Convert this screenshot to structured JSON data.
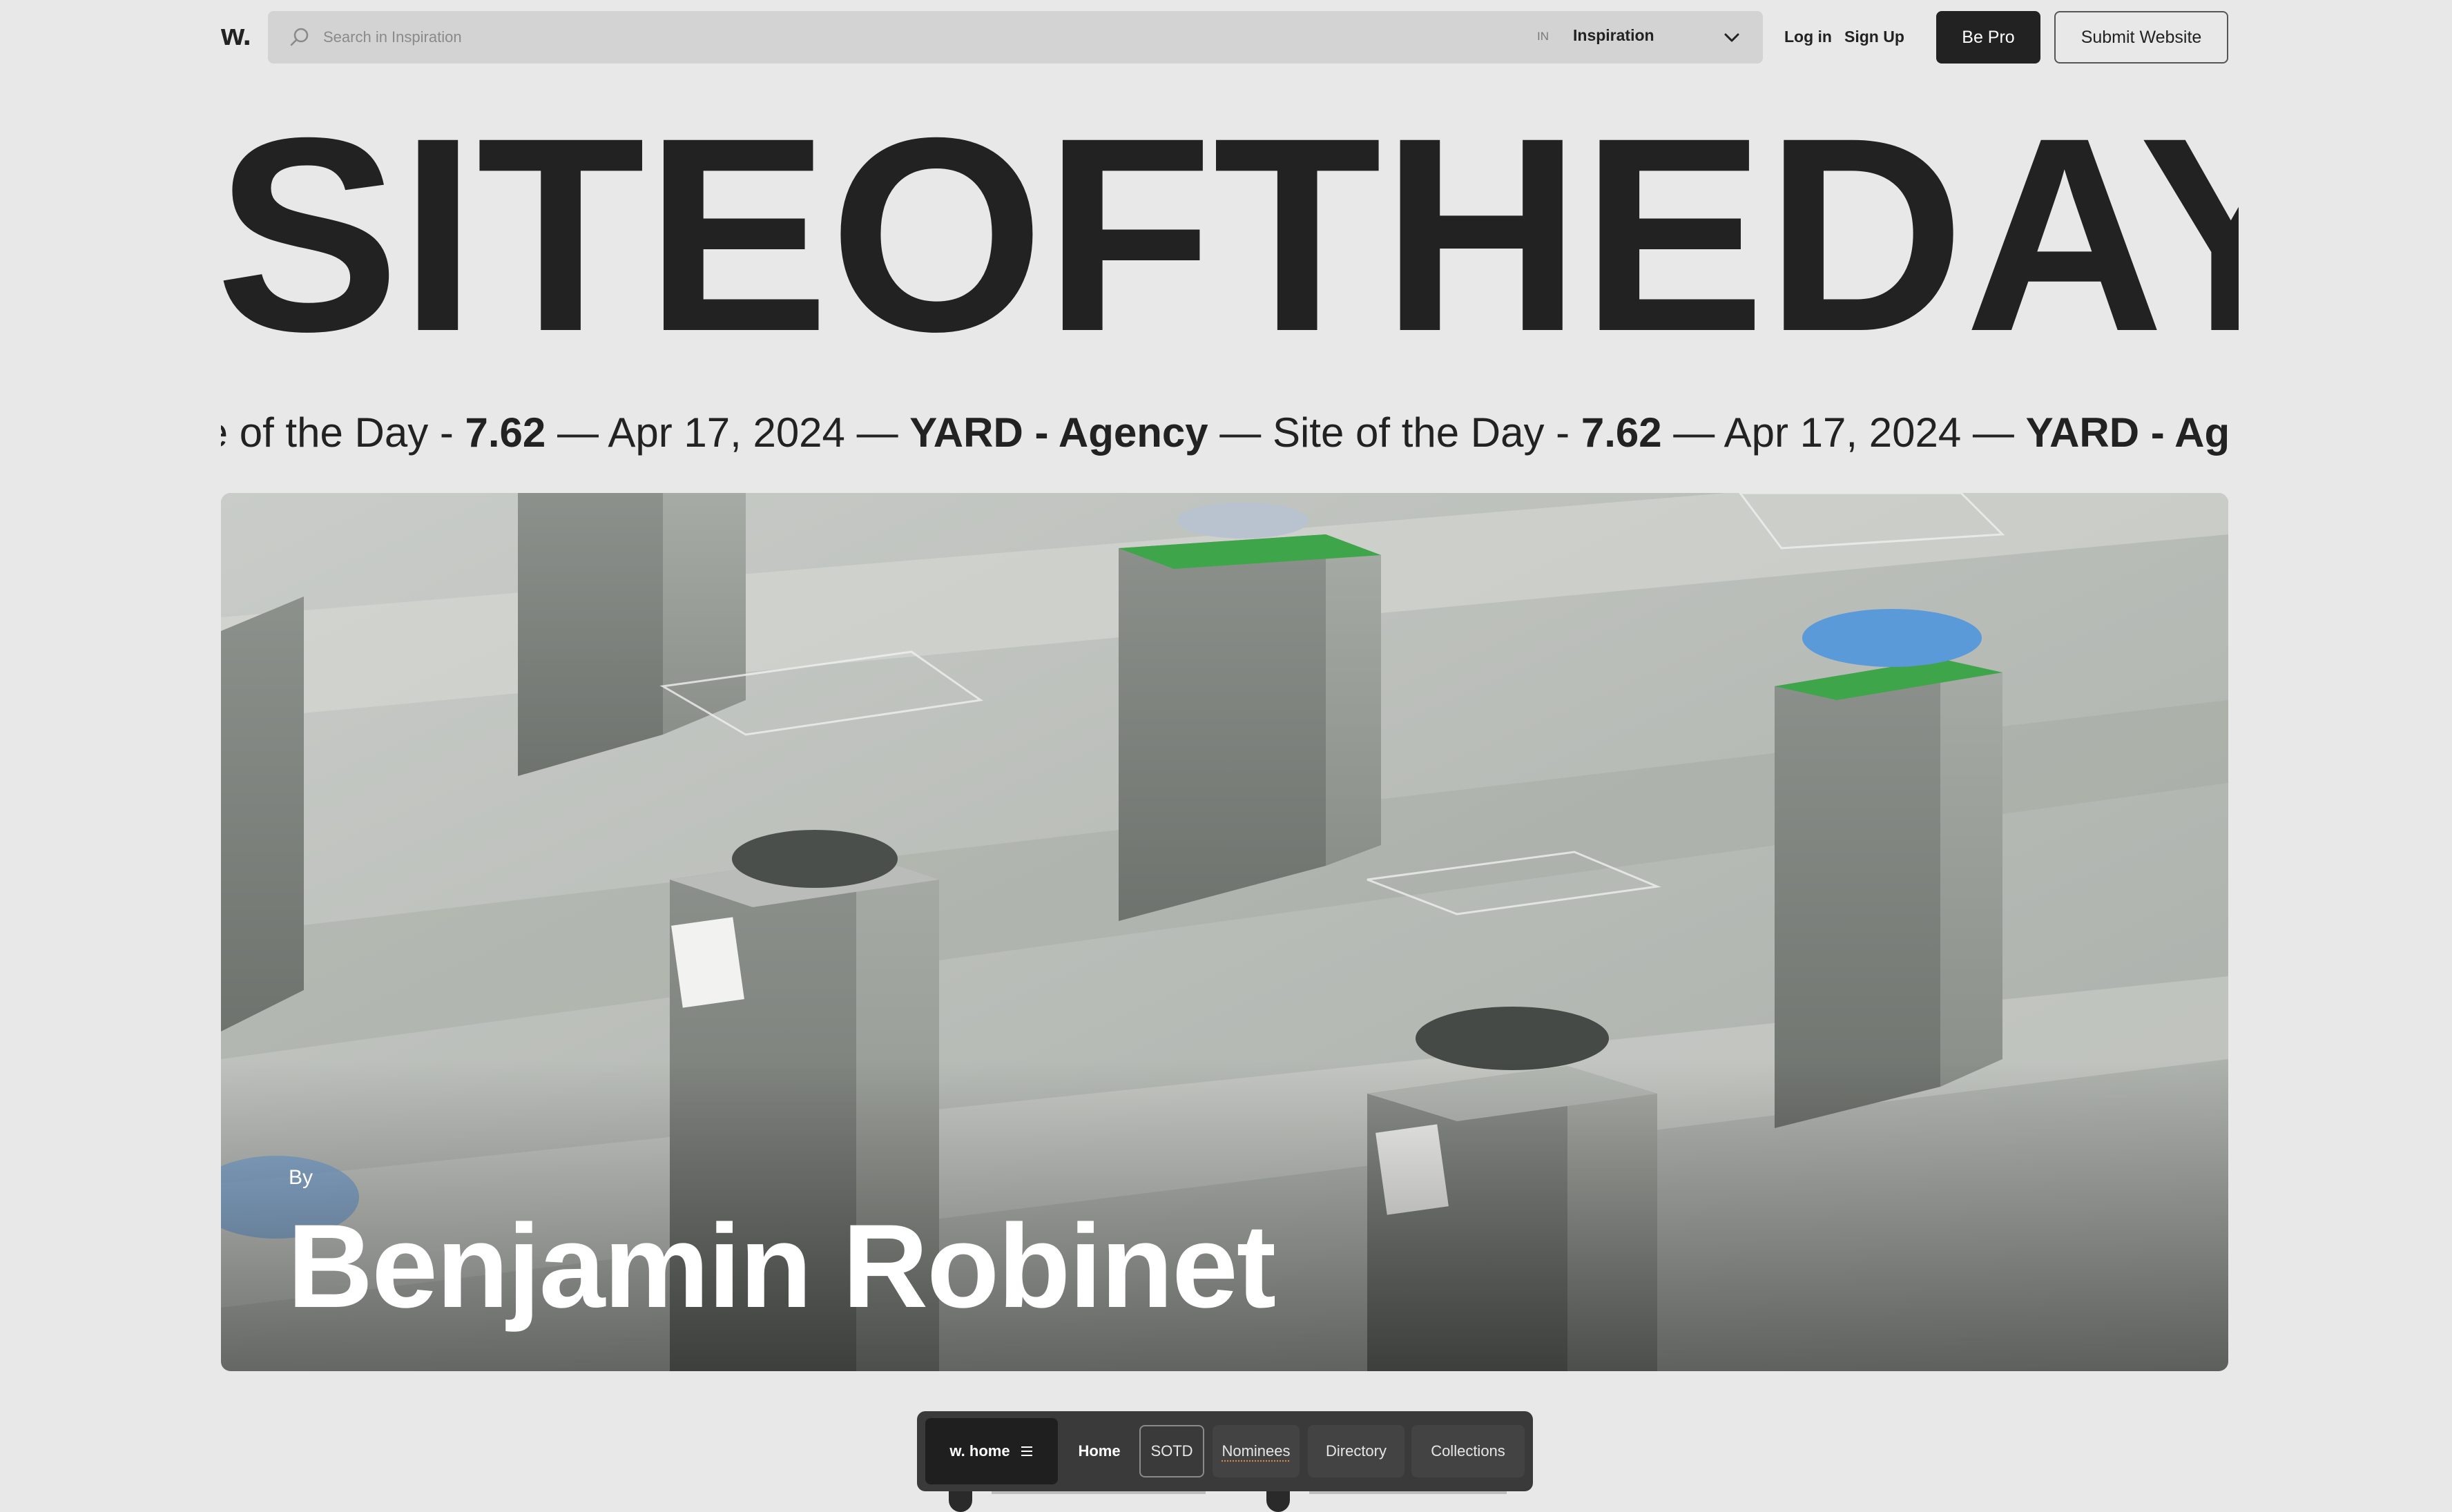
{
  "header": {
    "logo": "w.",
    "search_placeholder": "Search in Inspiration",
    "scope_prefix": "IN",
    "scope_value": "Inspiration",
    "login_label": "Log in",
    "signup_label": "Sign Up",
    "be_pro_label": "Be Pro",
    "submit_label": "Submit Website"
  },
  "headline": {
    "words": [
      "SITE",
      "OF",
      "THE",
      "DAY"
    ]
  },
  "ticker": {
    "segment_1_tail": "te of the Day - ",
    "score_1": "7.62",
    "sep_1": " — Apr 17, 2024 — ",
    "agency_1": "YARD - Agency",
    "sep_2": " — Site of the Day - ",
    "score_2": "7.62",
    "sep_3": " — Apr 17, 2024 — ",
    "agency_2_partial": "YARD - Age"
  },
  "hero": {
    "by_label": "By",
    "author": "Benjamin Robinet"
  },
  "bottom_nav": {
    "menu_label": "w. home",
    "home": "Home",
    "sotd": "SOTD",
    "nominees": "Nominees",
    "directory": "Directory",
    "collections": "Collections"
  },
  "colors": {
    "background": "#e8e8e8",
    "text": "#222222",
    "search_bg": "#d3d3d3",
    "nav_bg": "#3a3a3a"
  }
}
